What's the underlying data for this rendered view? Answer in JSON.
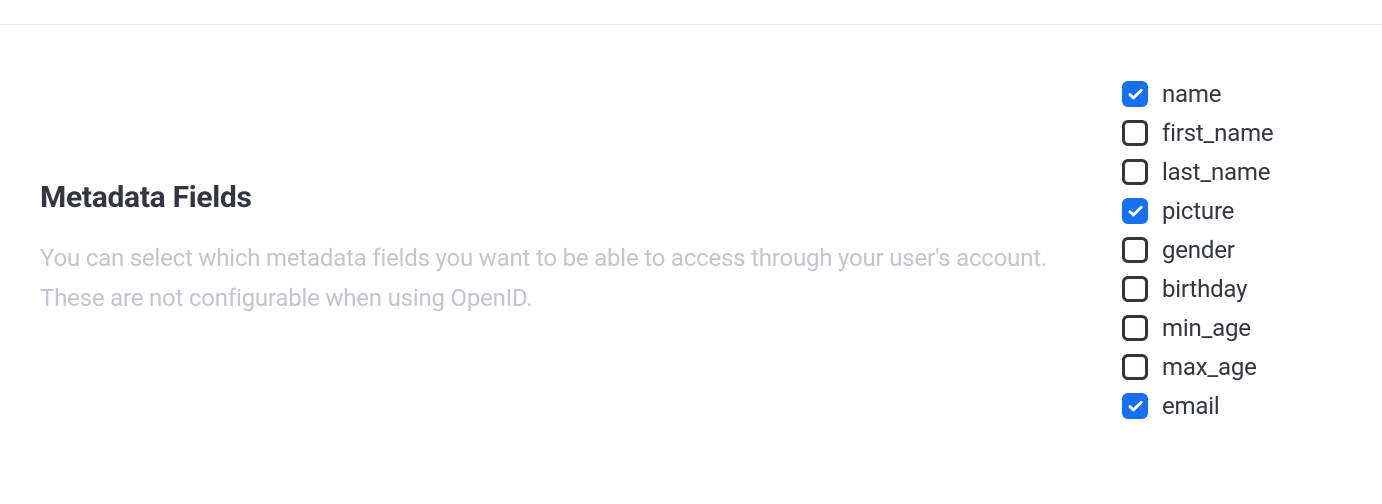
{
  "section": {
    "heading": "Metadata Fields",
    "description": "You can select which metadata fields you want to be able to access through your user's account. These are not configurable when using OpenID."
  },
  "fields": [
    {
      "label": "name",
      "checked": true
    },
    {
      "label": "first_name",
      "checked": false
    },
    {
      "label": "last_name",
      "checked": false
    },
    {
      "label": "picture",
      "checked": true
    },
    {
      "label": "gender",
      "checked": false
    },
    {
      "label": "birthday",
      "checked": false
    },
    {
      "label": "min_age",
      "checked": false
    },
    {
      "label": "max_age",
      "checked": false
    },
    {
      "label": "email",
      "checked": true
    }
  ]
}
